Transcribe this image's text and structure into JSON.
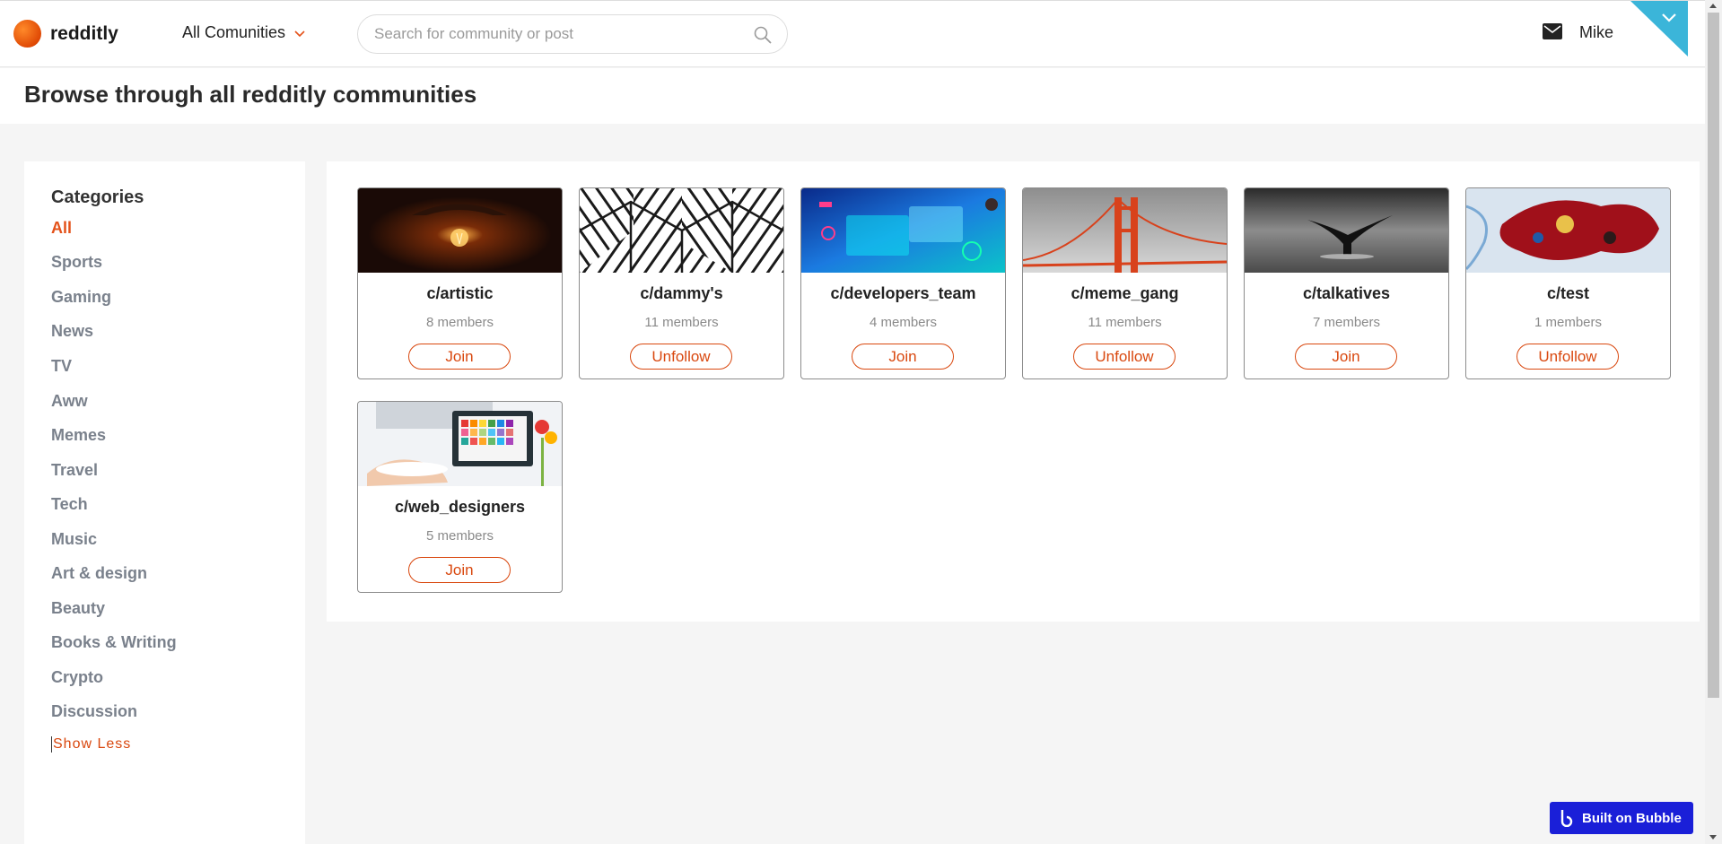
{
  "header": {
    "logo_text": "redditly",
    "communities_label": "All Comunities",
    "search_placeholder": "Search for community or post",
    "user_name": "Mike",
    "corner_icon": "chevron-down-icon"
  },
  "page_title": "Browse through all redditly communities",
  "sidebar": {
    "title": "Categories",
    "items": [
      {
        "label": "All",
        "active": true
      },
      {
        "label": "Sports"
      },
      {
        "label": "Gaming"
      },
      {
        "label": "News"
      },
      {
        "label": "TV"
      },
      {
        "label": "Aww"
      },
      {
        "label": "Memes"
      },
      {
        "label": "Travel"
      },
      {
        "label": "Tech"
      },
      {
        "label": "Music"
      },
      {
        "label": "Art & design"
      },
      {
        "label": "Beauty"
      },
      {
        "label": "Books & Writing"
      },
      {
        "label": "Crypto"
      },
      {
        "label": "Discussion"
      }
    ],
    "show_less": "Show Less"
  },
  "communities": [
    {
      "name": "c/artistic",
      "members": "8 members",
      "action": "Join",
      "image": "lightbulb"
    },
    {
      "name": "c/dammy's",
      "members": "11 members",
      "action": "Unfollow",
      "image": "pattern"
    },
    {
      "name": "c/developers_team",
      "members": "4 members",
      "action": "Join",
      "image": "tech"
    },
    {
      "name": "c/meme_gang",
      "members": "11 members",
      "action": "Unfollow",
      "image": "bridge"
    },
    {
      "name": "c/talkatives",
      "members": "7 members",
      "action": "Join",
      "image": "whale"
    },
    {
      "name": "c/test",
      "members": "1 members",
      "action": "Unfollow",
      "image": "paint"
    },
    {
      "name": "c/web_designers",
      "members": "5 members",
      "action": "Join",
      "image": "desk"
    }
  ],
  "badge": {
    "label": "Built on Bubble",
    "icon": "bubble-logo-icon"
  },
  "colors": {
    "accent": "#d9480f",
    "category_text": "#7a818c",
    "badge_bg": "#1a1fd8"
  }
}
